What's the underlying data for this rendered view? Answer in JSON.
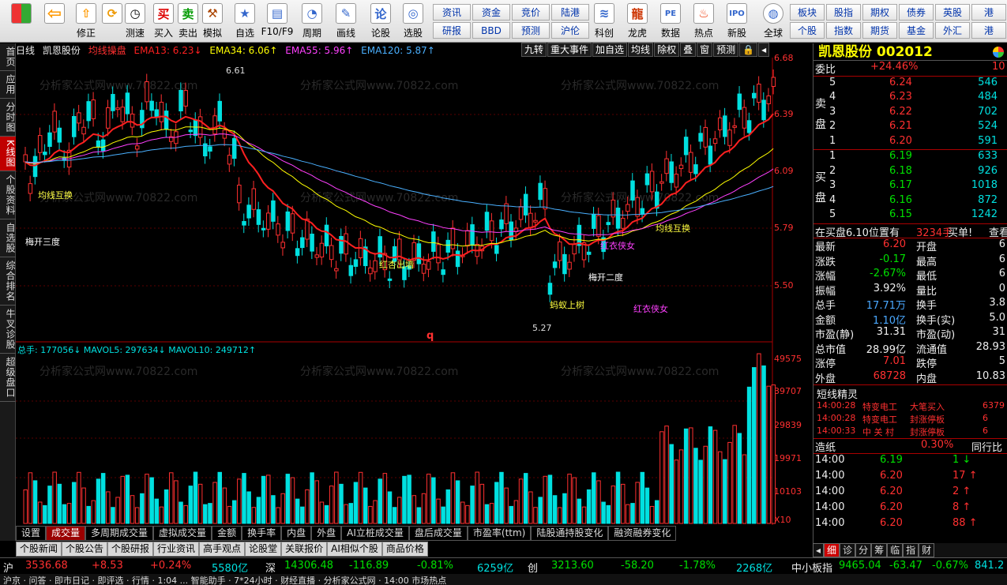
{
  "toolbar": {
    "buttons": [
      "修正",
      "测速",
      "买入",
      "卖出",
      "模拟",
      "自选",
      "F10/F9",
      "周期",
      "画线",
      "论股",
      "选股"
    ],
    "grid1": [
      "资讯",
      "资金",
      "竞价",
      "陆港",
      "研报",
      "BBD",
      "预测",
      "沪伦"
    ],
    "mid_buttons": [
      "科创",
      "龙虎",
      "数据",
      "热点",
      "新股",
      "全球"
    ],
    "grid2": [
      "板块",
      "股指",
      "期权",
      "债券",
      "英股",
      "港",
      "个股",
      "指数",
      "期货",
      "基金",
      "外汇",
      "港"
    ]
  },
  "left_tabs": [
    "首页",
    "应用",
    "分时图",
    "K线图",
    "个股资料",
    "自选股",
    "综合排名",
    "牛叉诊股",
    "超级盘口"
  ],
  "chart": {
    "period": "日线",
    "stock": "凯恩股份",
    "strategy": "均线操盘",
    "ema13": "EMA13: 6.23↓",
    "ema34": "EMA34: 6.06↑",
    "ema55": "EMA55: 5.96↑",
    "ema120": "EMA120: 5.87↑",
    "menu": [
      "九转",
      "重大事件",
      "加自选",
      "均线",
      "除权",
      "叠",
      "窗",
      "预测"
    ],
    "price_axis": [
      "6.68",
      "6.39",
      "6.09",
      "5.79",
      "5.50"
    ],
    "vol_axis": [
      "49575",
      "39707",
      "29839",
      "19971",
      "10103",
      "X10"
    ],
    "high_label": "6.61",
    "low_label": "5.27",
    "annotations": [
      "均线互换",
      "梅开三度",
      "红杏出墙",
      "红衣侠女",
      "均线互换",
      "梅开二度",
      "蚂蚁上树",
      "红衣侠女"
    ],
    "q_marker": "q",
    "vol_info": "总手: 177056↓ MAVOL5: 297634↓ MAVOL10: 249712↑",
    "watermark": "分析家公式网www.70822.com"
  },
  "bottom_tabs1": [
    "设置",
    "成交量",
    "多周期成交量",
    "虚拟成交量",
    "金额",
    "换手率",
    "内盘",
    "外盘",
    "AI立桩成交量",
    "盘后成交量",
    "市盈率(ttm)",
    "陆股通持股变化",
    "融资融券变化"
  ],
  "bottom_tabs2": [
    "个股新闻",
    "个股公告",
    "个股研报",
    "行业资讯",
    "高手观点",
    "论股堂",
    "关联报价",
    "AI相似个股",
    "商品价格"
  ],
  "quote": {
    "title": "凯恩股份 002012",
    "weibi_label": "委比",
    "weibi": "+24.46%",
    "weibi_tail": "10",
    "sell_side": "卖盘",
    "buy_side": "买盘",
    "sell": [
      {
        "n": "5",
        "p": "6.24",
        "v": "546"
      },
      {
        "n": "4",
        "p": "6.23",
        "v": "484"
      },
      {
        "n": "3",
        "p": "6.22",
        "v": "702"
      },
      {
        "n": "2",
        "p": "6.21",
        "v": "524"
      },
      {
        "n": "1",
        "p": "6.20",
        "v": "591"
      }
    ],
    "buy": [
      {
        "n": "1",
        "p": "6.19",
        "v": "633"
      },
      {
        "n": "2",
        "p": "6.18",
        "v": "926"
      },
      {
        "n": "3",
        "p": "6.17",
        "v": "1018"
      },
      {
        "n": "4",
        "p": "6.16",
        "v": "872"
      },
      {
        "n": "5",
        "p": "6.15",
        "v": "1242"
      }
    ],
    "zaimai": "在买盘6.10位置有",
    "zaimai_v": "3234手",
    "zaimai_b": "买单!",
    "zaimai_link": "查看",
    "stats": [
      {
        "l": "最新",
        "v": "6.20",
        "l2": "开盘",
        "v2": "6"
      },
      {
        "l": "涨跌",
        "v": "-0.17",
        "l2": "最高",
        "v2": "6"
      },
      {
        "l": "涨幅",
        "v": "-2.67%",
        "l2": "最低",
        "v2": "6"
      },
      {
        "l": "振幅",
        "v": "3.92%",
        "l2": "量比",
        "v2": "0"
      },
      {
        "l": "总手",
        "v": "17.71万",
        "l2": "换手",
        "v2": "3.8"
      },
      {
        "l": "金额",
        "v": "1.10亿",
        "l2": "换手(实)",
        "v2": "5.0"
      },
      {
        "l": "市盈(静)",
        "v": "31.31",
        "l2": "市盈(动)",
        "v2": "31"
      },
      {
        "l": "总市值",
        "v": "28.99亿",
        "l2": "流通值",
        "v2": "28.93"
      },
      {
        "l": "涨停",
        "v": "7.01",
        "l2": "跌停",
        "v2": "5"
      },
      {
        "l": "外盘",
        "v": "68728",
        "l2": "内盘",
        "v2": "10.83"
      }
    ],
    "short_title": "短线精灵",
    "short": [
      {
        "t": "14:00:28",
        "s": "特变电工",
        "a": "大笔买入",
        "v": "6379"
      },
      {
        "t": "14:00:28",
        "s": "特变电工",
        "a": "封涨停板",
        "v": "6"
      },
      {
        "t": "14:00:33",
        "s": "中 关 村",
        "a": "封涨停板",
        "v": "6"
      }
    ],
    "zaozhi": "造纸",
    "zaozhi_pct": "0.30%",
    "tongqi": "同行比",
    "tongqi2": "比",
    "ticks": [
      {
        "t": "14:00",
        "p": "6.19",
        "v": "1",
        "d": "↓"
      },
      {
        "t": "14:00",
        "p": "6.20",
        "v": "17",
        "d": "↑"
      },
      {
        "t": "14:00",
        "p": "6.20",
        "v": "2",
        "d": "↑"
      },
      {
        "t": "14:00",
        "p": "6.20",
        "v": "8",
        "d": "↑"
      },
      {
        "t": "14:00",
        "p": "6.20",
        "v": "88",
        "d": "↑"
      }
    ]
  },
  "rp_tabs": [
    "细",
    "诊",
    "分",
    "筹",
    "临",
    "指",
    "财"
  ],
  "status": {
    "sh_label": "沪",
    "sh_val": "3536.68",
    "sh_chg": "+8.53",
    "sh_pct": "+0.24%",
    "sh_amt": "5580亿",
    "sz_label": "深",
    "sz_val": "14306.48",
    "sz_chg": "-116.89",
    "sz_pct": "-0.81%",
    "sz_amt": "6259亿",
    "cy_label": "创",
    "cy_val": "3213.60",
    "cy_chg": "-58.20",
    "cy_pct": "-1.78%",
    "cy_amt": "2268亿",
    "zx_label": "中小板指",
    "zx_val": "9465.04",
    "zx_chg": "-63.47",
    "zx_pct": "-0.67%",
    "zx_amt": "841.2"
  },
  "ticker": "沪京 · 问答 · 即市日记 · 即评选 · 行情 · 1:04 ... 智能助手 · 7*24小时 · 财经直播 · 分析家公式网 · 14:00 市场热点",
  "colors": {
    "up": "#ff3030",
    "down": "#00e0e0",
    "ema13": "#ff2020",
    "ema34": "#ffff00",
    "ema55": "#ff40ff",
    "ema120": "#4ab0ff"
  }
}
